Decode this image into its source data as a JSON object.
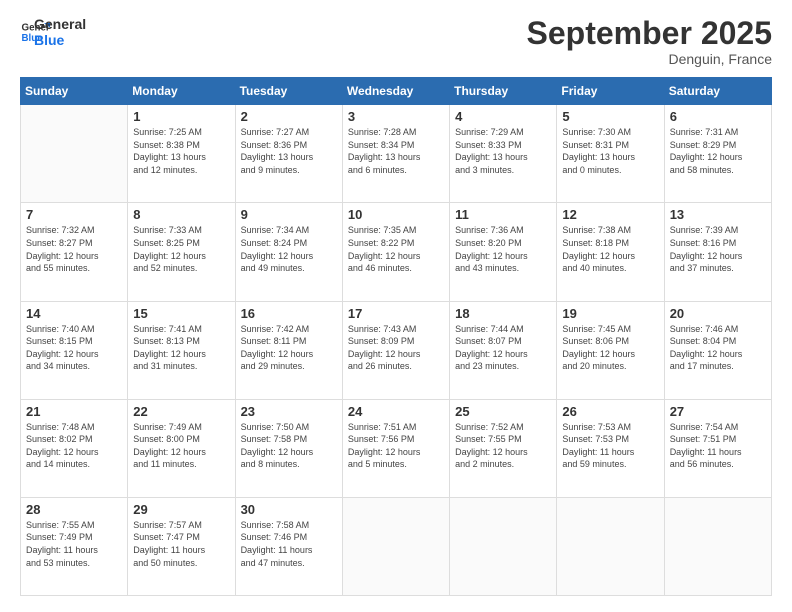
{
  "logo": {
    "line1": "General",
    "line2": "Blue"
  },
  "title": "September 2025",
  "location": "Denguin, France",
  "days_header": [
    "Sunday",
    "Monday",
    "Tuesday",
    "Wednesday",
    "Thursday",
    "Friday",
    "Saturday"
  ],
  "weeks": [
    [
      {
        "day": "",
        "info": ""
      },
      {
        "day": "1",
        "info": "Sunrise: 7:25 AM\nSunset: 8:38 PM\nDaylight: 13 hours\nand 12 minutes."
      },
      {
        "day": "2",
        "info": "Sunrise: 7:27 AM\nSunset: 8:36 PM\nDaylight: 13 hours\nand 9 minutes."
      },
      {
        "day": "3",
        "info": "Sunrise: 7:28 AM\nSunset: 8:34 PM\nDaylight: 13 hours\nand 6 minutes."
      },
      {
        "day": "4",
        "info": "Sunrise: 7:29 AM\nSunset: 8:33 PM\nDaylight: 13 hours\nand 3 minutes."
      },
      {
        "day": "5",
        "info": "Sunrise: 7:30 AM\nSunset: 8:31 PM\nDaylight: 13 hours\nand 0 minutes."
      },
      {
        "day": "6",
        "info": "Sunrise: 7:31 AM\nSunset: 8:29 PM\nDaylight: 12 hours\nand 58 minutes."
      }
    ],
    [
      {
        "day": "7",
        "info": "Sunrise: 7:32 AM\nSunset: 8:27 PM\nDaylight: 12 hours\nand 55 minutes."
      },
      {
        "day": "8",
        "info": "Sunrise: 7:33 AM\nSunset: 8:25 PM\nDaylight: 12 hours\nand 52 minutes."
      },
      {
        "day": "9",
        "info": "Sunrise: 7:34 AM\nSunset: 8:24 PM\nDaylight: 12 hours\nand 49 minutes."
      },
      {
        "day": "10",
        "info": "Sunrise: 7:35 AM\nSunset: 8:22 PM\nDaylight: 12 hours\nand 46 minutes."
      },
      {
        "day": "11",
        "info": "Sunrise: 7:36 AM\nSunset: 8:20 PM\nDaylight: 12 hours\nand 43 minutes."
      },
      {
        "day": "12",
        "info": "Sunrise: 7:38 AM\nSunset: 8:18 PM\nDaylight: 12 hours\nand 40 minutes."
      },
      {
        "day": "13",
        "info": "Sunrise: 7:39 AM\nSunset: 8:16 PM\nDaylight: 12 hours\nand 37 minutes."
      }
    ],
    [
      {
        "day": "14",
        "info": "Sunrise: 7:40 AM\nSunset: 8:15 PM\nDaylight: 12 hours\nand 34 minutes."
      },
      {
        "day": "15",
        "info": "Sunrise: 7:41 AM\nSunset: 8:13 PM\nDaylight: 12 hours\nand 31 minutes."
      },
      {
        "day": "16",
        "info": "Sunrise: 7:42 AM\nSunset: 8:11 PM\nDaylight: 12 hours\nand 29 minutes."
      },
      {
        "day": "17",
        "info": "Sunrise: 7:43 AM\nSunset: 8:09 PM\nDaylight: 12 hours\nand 26 minutes."
      },
      {
        "day": "18",
        "info": "Sunrise: 7:44 AM\nSunset: 8:07 PM\nDaylight: 12 hours\nand 23 minutes."
      },
      {
        "day": "19",
        "info": "Sunrise: 7:45 AM\nSunset: 8:06 PM\nDaylight: 12 hours\nand 20 minutes."
      },
      {
        "day": "20",
        "info": "Sunrise: 7:46 AM\nSunset: 8:04 PM\nDaylight: 12 hours\nand 17 minutes."
      }
    ],
    [
      {
        "day": "21",
        "info": "Sunrise: 7:48 AM\nSunset: 8:02 PM\nDaylight: 12 hours\nand 14 minutes."
      },
      {
        "day": "22",
        "info": "Sunrise: 7:49 AM\nSunset: 8:00 PM\nDaylight: 12 hours\nand 11 minutes."
      },
      {
        "day": "23",
        "info": "Sunrise: 7:50 AM\nSunset: 7:58 PM\nDaylight: 12 hours\nand 8 minutes."
      },
      {
        "day": "24",
        "info": "Sunrise: 7:51 AM\nSunset: 7:56 PM\nDaylight: 12 hours\nand 5 minutes."
      },
      {
        "day": "25",
        "info": "Sunrise: 7:52 AM\nSunset: 7:55 PM\nDaylight: 12 hours\nand 2 minutes."
      },
      {
        "day": "26",
        "info": "Sunrise: 7:53 AM\nSunset: 7:53 PM\nDaylight: 11 hours\nand 59 minutes."
      },
      {
        "day": "27",
        "info": "Sunrise: 7:54 AM\nSunset: 7:51 PM\nDaylight: 11 hours\nand 56 minutes."
      }
    ],
    [
      {
        "day": "28",
        "info": "Sunrise: 7:55 AM\nSunset: 7:49 PM\nDaylight: 11 hours\nand 53 minutes."
      },
      {
        "day": "29",
        "info": "Sunrise: 7:57 AM\nSunset: 7:47 PM\nDaylight: 11 hours\nand 50 minutes."
      },
      {
        "day": "30",
        "info": "Sunrise: 7:58 AM\nSunset: 7:46 PM\nDaylight: 11 hours\nand 47 minutes."
      },
      {
        "day": "",
        "info": ""
      },
      {
        "day": "",
        "info": ""
      },
      {
        "day": "",
        "info": ""
      },
      {
        "day": "",
        "info": ""
      }
    ]
  ]
}
